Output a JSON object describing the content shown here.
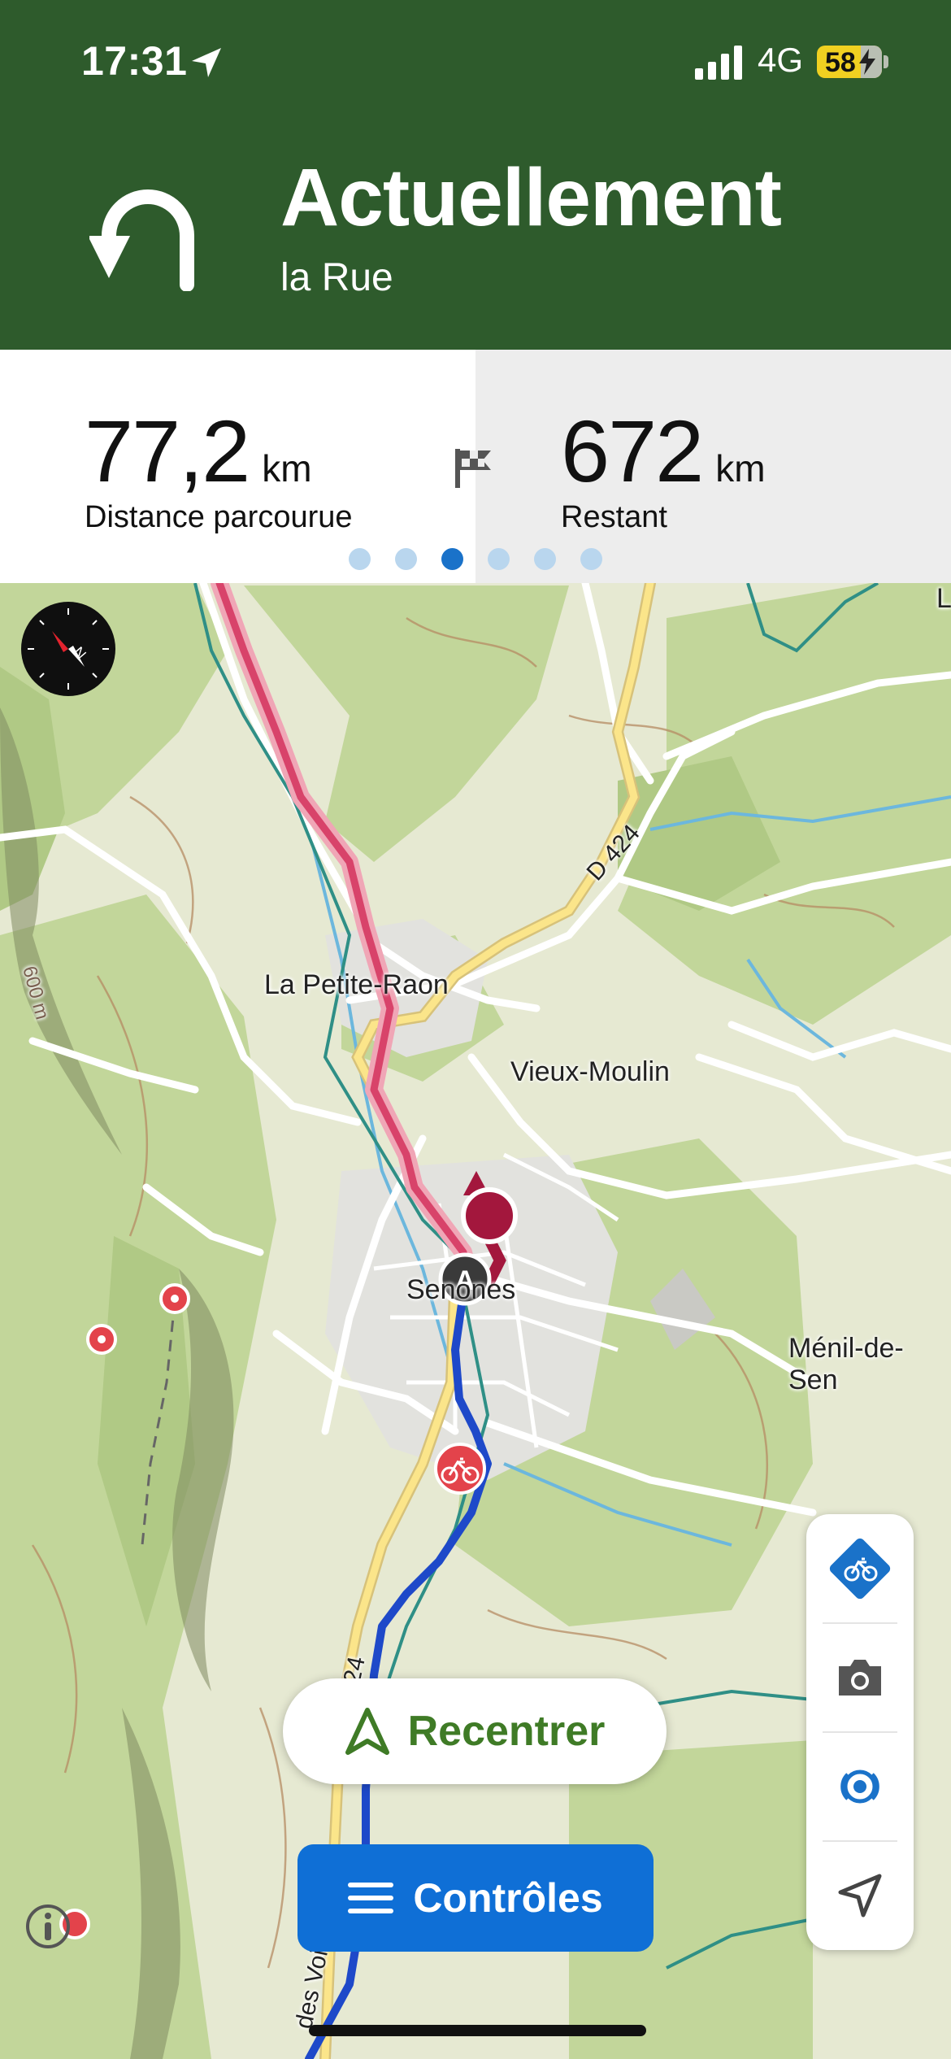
{
  "status_bar": {
    "time": "17:31",
    "network": "4G",
    "battery": "58",
    "icons": [
      "location-arrow-icon",
      "signal-bars-icon",
      "battery-charging-icon"
    ]
  },
  "navigation": {
    "maneuver": "Actuellement",
    "street": "la Rue",
    "maneuver_icon": "u-turn-left-icon"
  },
  "stats": {
    "traveled": {
      "value": "77,2",
      "unit": "km",
      "label": "Distance parcourue"
    },
    "remaining": {
      "value": "672",
      "unit": "km",
      "label": "Restant"
    },
    "flag_icon": "finish-flag-icon",
    "pages": {
      "count": 6,
      "active_index": 2
    }
  },
  "map": {
    "places": {
      "petite_raon": "La Petite-Raon",
      "vieux_moulin": "Vieux-Moulin",
      "senones": "Senones",
      "menil": "Ménil-de-Sen",
      "road_d424": "D 424",
      "road_24": "24",
      "road_voitu": "des Voitu",
      "contour": "600 m",
      "edge_letter": "L"
    },
    "start_marker": "A",
    "colors": {
      "route_done": "#d8436a",
      "route_ahead": "#1e49c9",
      "position": "#a3173d",
      "header": "#2e5b2c",
      "accent": "#0f6fd6"
    }
  },
  "buttons": {
    "recenter": "Recentrer",
    "controls": "Contrôles"
  },
  "side_panel": [
    "bike-route-icon",
    "camera-icon",
    "broadcast-icon",
    "navigate-arrow-icon"
  ]
}
